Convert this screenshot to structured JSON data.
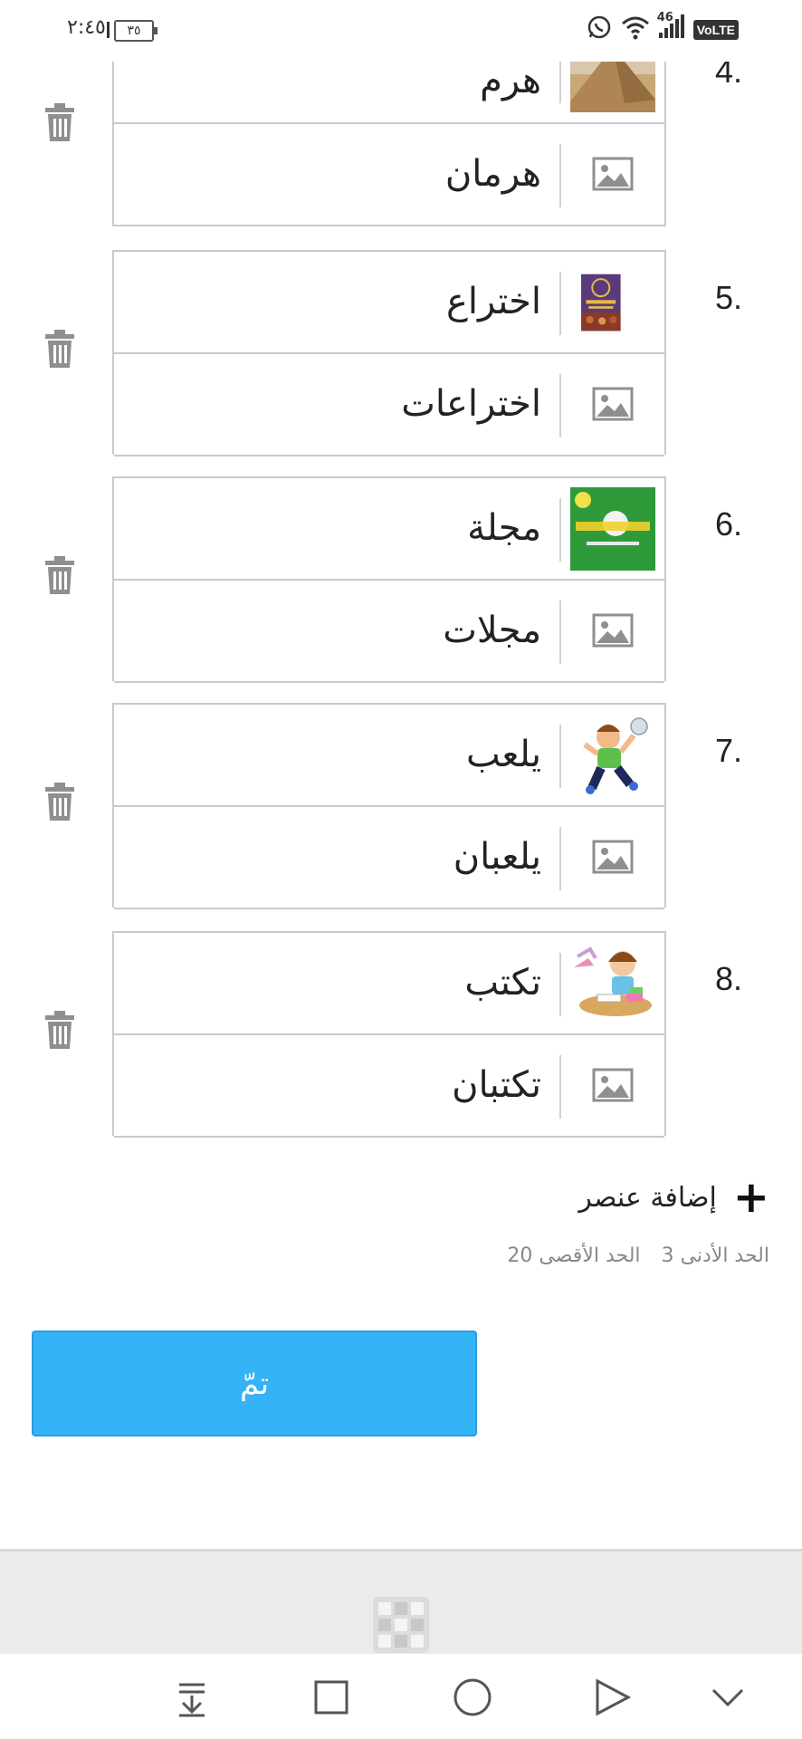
{
  "status_bar": {
    "time": "٢:٤٥",
    "battery": "٣٥",
    "network": "46",
    "volte": "VoLTE",
    "icons": [
      "whatsapp-icon",
      "wifi-icon",
      "signal-icon",
      "volte-icon",
      "battery-icon"
    ]
  },
  "items": [
    {
      "number": "4.",
      "singular": "هرم",
      "plural": "هرمان",
      "thumb": "pyramid"
    },
    {
      "number": "5.",
      "singular": "اختراع",
      "plural": "اختراعات",
      "thumb": "book-cover"
    },
    {
      "number": "6.",
      "singular": "مجلة",
      "plural": "مجلات",
      "thumb": "magazine"
    },
    {
      "number": "7.",
      "singular": "يلعب",
      "plural": "يلعبان",
      "thumb": "boy-playing"
    },
    {
      "number": "8.",
      "singular": "تكتب",
      "plural": "تكتبان",
      "thumb": "girl-writing"
    }
  ],
  "add_item": {
    "label": "إضافة عنصر"
  },
  "limits": {
    "min": "الحد الأدنى 3",
    "max": "الحد الأقصى 20"
  },
  "done_button": {
    "label": "تمّ"
  },
  "colors": {
    "accent": "#35b3f7",
    "border": "#c9c9c9",
    "icon_gray": "#8f8f8f"
  }
}
